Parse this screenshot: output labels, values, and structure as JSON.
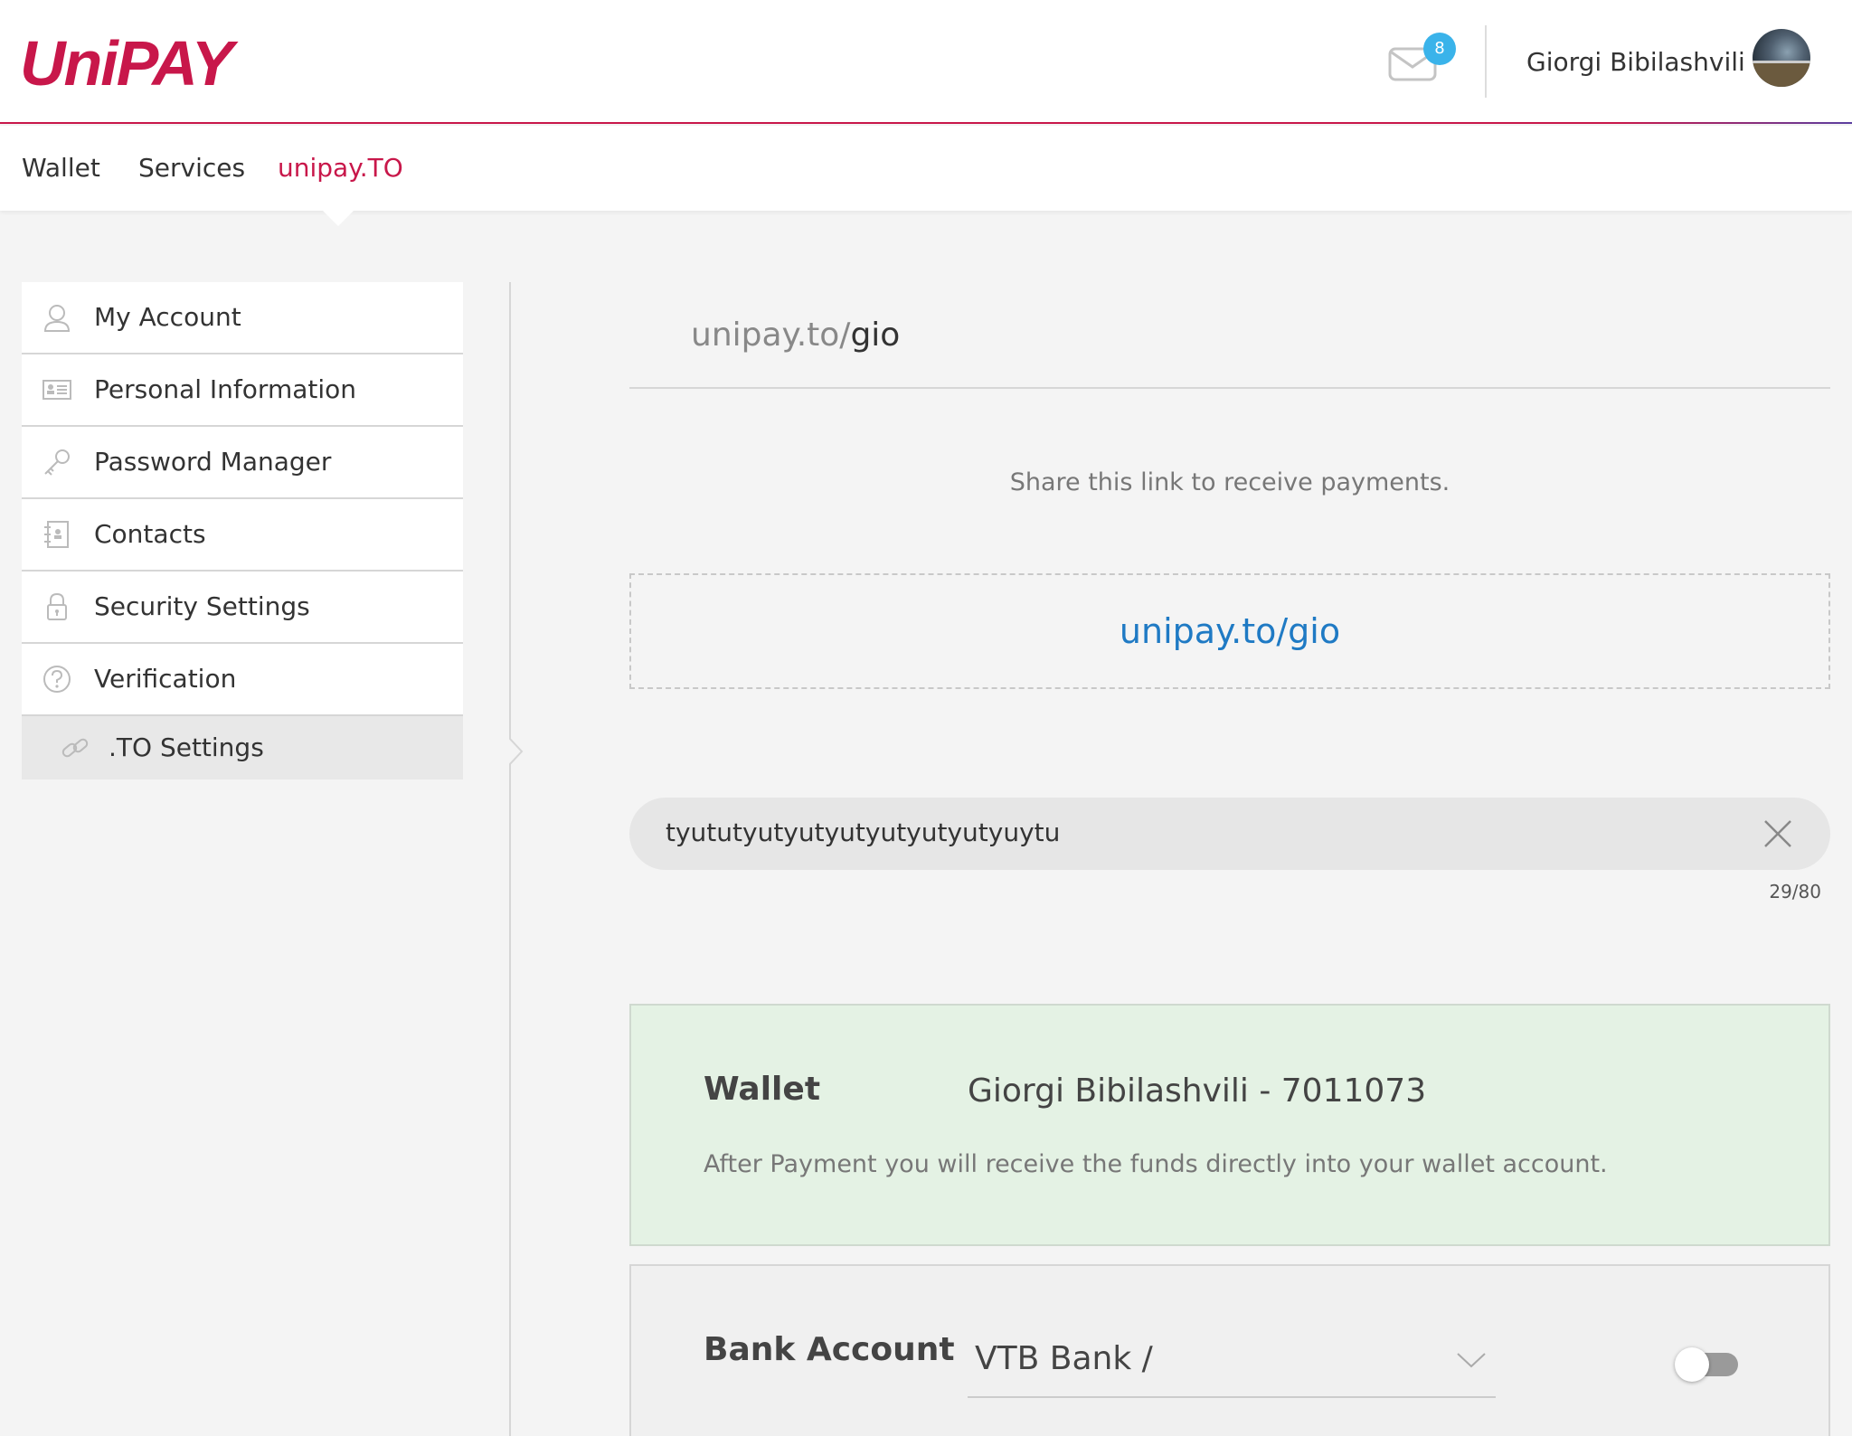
{
  "header": {
    "logo": "UniPAY",
    "messages_icon": "envelope-icon",
    "messages_count": "8",
    "user_name": "Giorgi Bibilashvili",
    "brand_color": "#c8174a",
    "badge_color": "#3ab3ea"
  },
  "nav": {
    "items": [
      {
        "label": "Wallet",
        "active": false
      },
      {
        "label": "Services",
        "active": false
      },
      {
        "label": "unipay.TO",
        "active": true
      }
    ]
  },
  "sidebar": {
    "items": [
      {
        "label": "My Account",
        "icon": "user-icon"
      },
      {
        "label": "Personal Information",
        "icon": "id-card-icon"
      },
      {
        "label": "Password Manager",
        "icon": "key-icon"
      },
      {
        "label": "Contacts",
        "icon": "address-book-icon"
      },
      {
        "label": "Security Settings",
        "icon": "lock-icon"
      },
      {
        "label": "Verification",
        "icon": "question-circle-icon"
      },
      {
        "label": ".TO Settings",
        "icon": "link-icon",
        "active": true
      }
    ]
  },
  "main": {
    "url_prefix": "unipay.to/",
    "url_slug": "gio",
    "share_text": "Share this link to receive payments.",
    "share_link": "unipay.to/gio",
    "description": {
      "value": "tyututyutyutyutyutyutyutyuytu",
      "counter": "29/80"
    },
    "wallet_card": {
      "title": "Wallet",
      "account": "Giorgi Bibilashvili - 7011073",
      "note": "After Payment you will receive the funds directly into your wallet account.",
      "bg_color": "#e4f2e4"
    },
    "bank_card": {
      "title": "Bank Account",
      "selected_bank": "VTB Bank /",
      "toggle_on": false
    }
  }
}
